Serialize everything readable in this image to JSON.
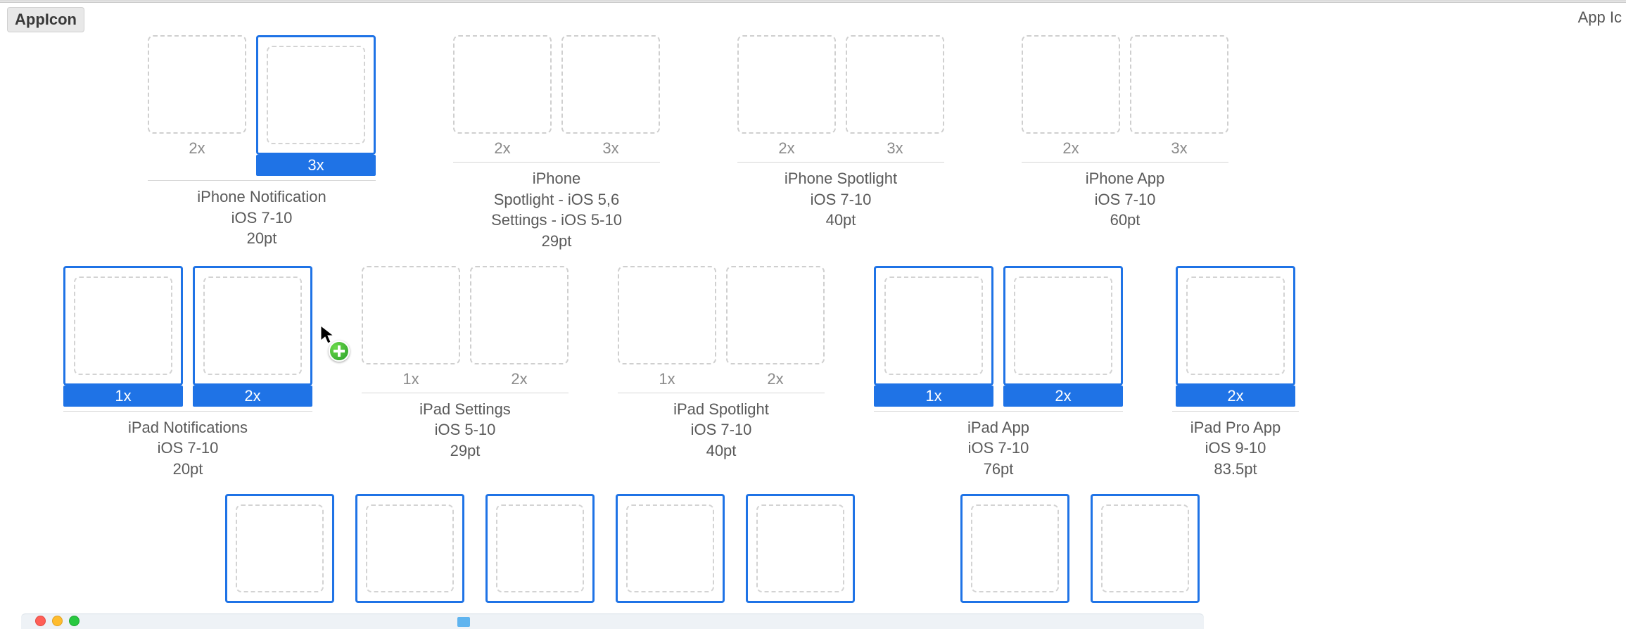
{
  "header": {
    "asset_name": "AppIcon",
    "right_label": "App Ic"
  },
  "row1": [
    {
      "title_lines": [
        "iPhone Notification",
        "iOS 7-10",
        "20pt"
      ],
      "wells": [
        {
          "scale": "2x",
          "selected": false
        },
        {
          "scale": "3x",
          "selected": true
        }
      ]
    },
    {
      "title_lines": [
        "iPhone",
        "Spotlight - iOS 5,6",
        "Settings - iOS 5-10",
        "29pt"
      ],
      "wells": [
        {
          "scale": "2x",
          "selected": false
        },
        {
          "scale": "3x",
          "selected": false
        }
      ]
    },
    {
      "title_lines": [
        "iPhone Spotlight",
        "iOS 7-10",
        "40pt"
      ],
      "wells": [
        {
          "scale": "2x",
          "selected": false
        },
        {
          "scale": "3x",
          "selected": false
        }
      ]
    },
    {
      "title_lines": [
        "iPhone App",
        "iOS 7-10",
        "60pt"
      ],
      "wells": [
        {
          "scale": "2x",
          "selected": false
        },
        {
          "scale": "3x",
          "selected": false
        }
      ]
    }
  ],
  "row2": [
    {
      "title_lines": [
        "iPad Notifications",
        "iOS 7-10",
        "20pt"
      ],
      "wells": [
        {
          "scale": "1x",
          "selected": true
        },
        {
          "scale": "2x",
          "selected": true
        }
      ]
    },
    {
      "title_lines": [
        "iPad Settings",
        "iOS 5-10",
        "29pt"
      ],
      "wells": [
        {
          "scale": "1x",
          "selected": false
        },
        {
          "scale": "2x",
          "selected": false
        }
      ]
    },
    {
      "title_lines": [
        "iPad Spotlight",
        "iOS 7-10",
        "40pt"
      ],
      "wells": [
        {
          "scale": "1x",
          "selected": false
        },
        {
          "scale": "2x",
          "selected": false
        }
      ]
    },
    {
      "title_lines": [
        "iPad App",
        "iOS 7-10",
        "76pt"
      ],
      "wells": [
        {
          "scale": "1x",
          "selected": true
        },
        {
          "scale": "2x",
          "selected": true
        }
      ]
    },
    {
      "title_lines": [
        "iPad Pro App",
        "iOS 9-10",
        "83.5pt"
      ],
      "wells": [
        {
          "scale": "2x",
          "selected": true
        }
      ]
    }
  ],
  "row3_count": 7,
  "cursor": {
    "type": "arrow-copy",
    "badge": "plus"
  }
}
